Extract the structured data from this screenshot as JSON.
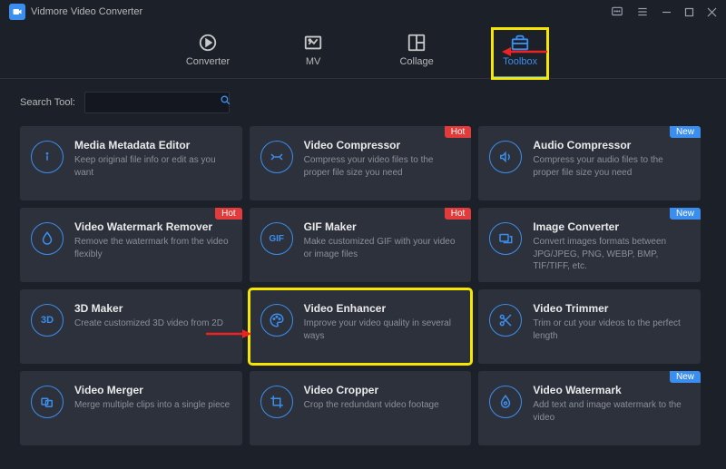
{
  "app": {
    "title": "Vidmore Video Converter"
  },
  "nav": [
    {
      "label": "Converter"
    },
    {
      "label": "MV"
    },
    {
      "label": "Collage"
    },
    {
      "label": "Toolbox"
    }
  ],
  "search": {
    "label": "Search Tool:",
    "placeholder": ""
  },
  "badges": {
    "hot": "Hot",
    "new": "New"
  },
  "tools": [
    {
      "title": "Media Metadata Editor",
      "desc": "Keep original file info or edit as you want",
      "badge": ""
    },
    {
      "title": "Video Compressor",
      "desc": "Compress your video files to the proper file size you need",
      "badge": "hot"
    },
    {
      "title": "Audio Compressor",
      "desc": "Compress your audio files to the proper file size you need",
      "badge": "new"
    },
    {
      "title": "Video Watermark Remover",
      "desc": "Remove the watermark from the video flexibly",
      "badge": "hot"
    },
    {
      "title": "GIF Maker",
      "desc": "Make customized GIF with your video or image files",
      "badge": "hot"
    },
    {
      "title": "Image Converter",
      "desc": "Convert images formats between JPG/JPEG, PNG, WEBP, BMP, TIF/TIFF, etc.",
      "badge": "new"
    },
    {
      "title": "3D Maker",
      "desc": "Create customized 3D video from 2D",
      "badge": ""
    },
    {
      "title": "Video Enhancer",
      "desc": "Improve your video quality in several ways",
      "badge": ""
    },
    {
      "title": "Video Trimmer",
      "desc": "Trim or cut your videos to the perfect length",
      "badge": ""
    },
    {
      "title": "Video Merger",
      "desc": "Merge multiple clips into a single piece",
      "badge": ""
    },
    {
      "title": "Video Cropper",
      "desc": "Crop the redundant video footage",
      "badge": ""
    },
    {
      "title": "Video Watermark",
      "desc": "Add text and image watermark to the video",
      "badge": "new"
    }
  ]
}
